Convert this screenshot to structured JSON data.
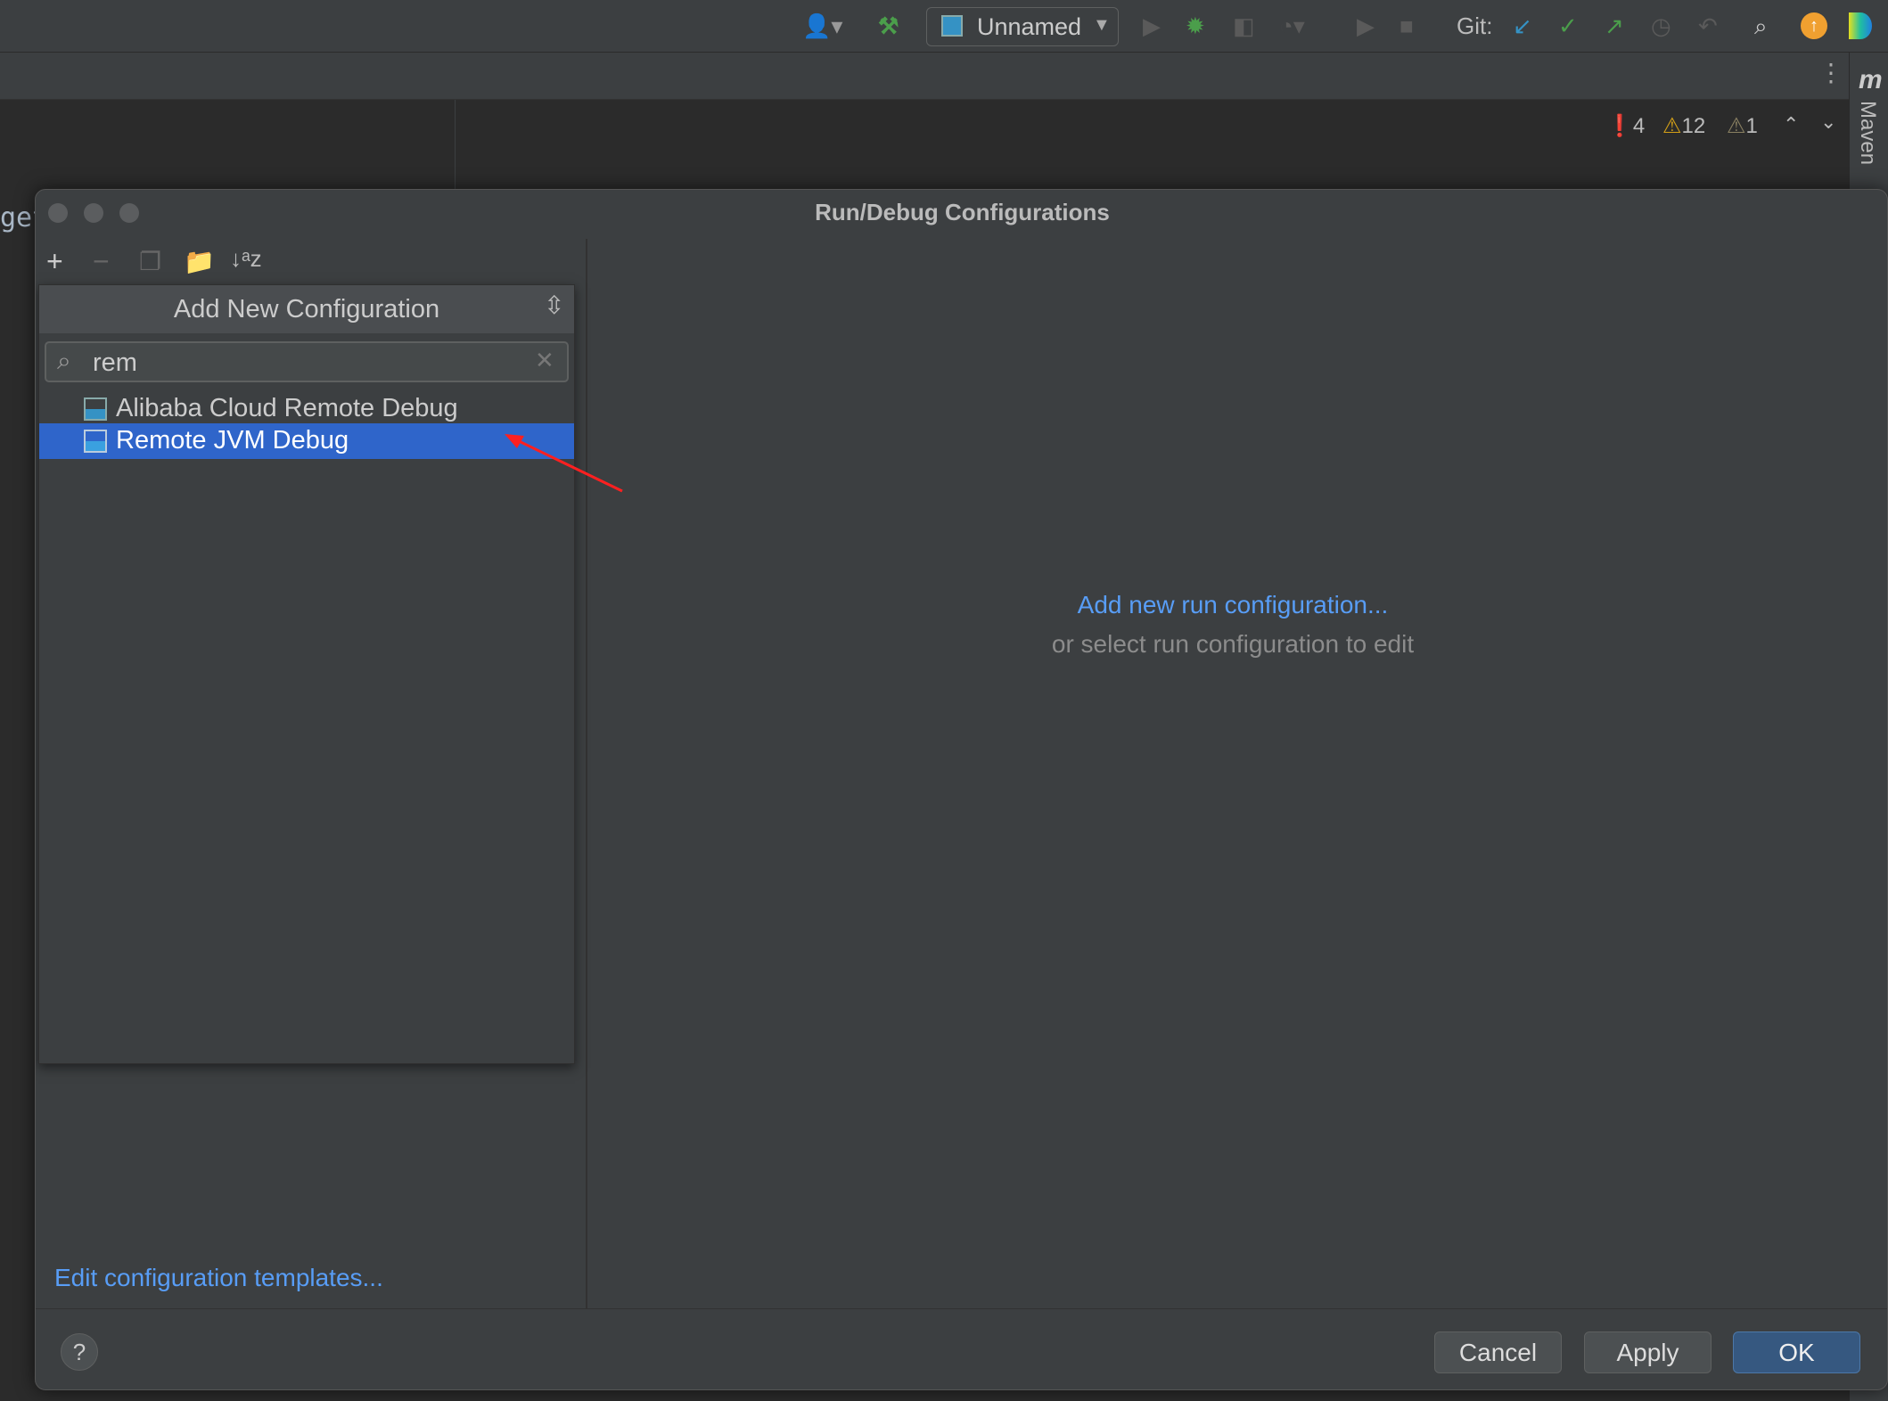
{
  "toolbar": {
    "run_config": "Unnamed",
    "git_label": "Git:",
    "icons": [
      "user-icon",
      "build-hammer-icon",
      "run-icon",
      "debug-bug-icon",
      "coverage-icon",
      "profile-icon",
      "run-alt-icon",
      "stop-icon",
      "git-update-icon",
      "git-commit-icon",
      "git-push-icon",
      "history-icon",
      "rollback-icon",
      "search-icon",
      "update-icon",
      "plugin-icon"
    ]
  },
  "inspections": {
    "errors": "4",
    "warnings": "12",
    "weak_warnings": "1"
  },
  "maven": {
    "label": "Maven",
    "glyph": "m"
  },
  "editor": {
    "fragment": "get"
  },
  "dialog": {
    "title": "Run/Debug Configurations",
    "popup": {
      "header": "Add New Configuration",
      "search_value": "rem",
      "items": [
        {
          "label": "Alibaba Cloud Remote Debug",
          "selected": false
        },
        {
          "label": "Remote JVM Debug",
          "selected": true
        }
      ]
    },
    "add_new_link": "Add new run configuration...",
    "hint": "or select run configuration to edit",
    "edit_templates_link": "Edit configuration templates...",
    "help": "?",
    "buttons": {
      "cancel": "Cancel",
      "apply": "Apply",
      "ok": "OK"
    }
  },
  "colors": {
    "accent": "#2f65ca",
    "link": "#589df6",
    "ok_button": "#365880",
    "annotation_arrow": "#ff2020"
  }
}
